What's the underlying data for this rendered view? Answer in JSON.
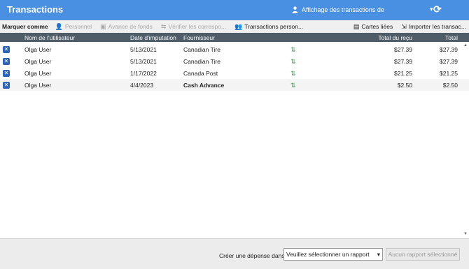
{
  "window": {
    "title": "Transactions"
  },
  "view": {
    "icon": "person-icon",
    "label": "Affichage des transactions de",
    "chevron": "▾",
    "refresh": "⟳"
  },
  "toolbar": {
    "mark_as": "Marquer comme",
    "personal": "Personnel",
    "advance": "Avance de fonds",
    "verify": "Vérifier les correspo...",
    "transactions_person": "Transactions person...",
    "linked_cards": "Cartes liées",
    "import": "Importer les transac..."
  },
  "columns": {
    "user": "Nom de l'utilisateur",
    "date": "Date d'imputation",
    "vendor": "Fournisseur",
    "receipt_total": "Total du reçu",
    "total": "Total"
  },
  "rows": [
    {
      "user": "Olga User",
      "date": "5/13/2021",
      "vendor": "Canadian Tire",
      "receipt_total": "$27.39",
      "total": "$27.39"
    },
    {
      "user": "Olga User",
      "date": "5/13/2021",
      "vendor": "Canadian Tire",
      "receipt_total": "$27.39",
      "total": "$27.39"
    },
    {
      "user": "Olga User",
      "date": "1/17/2022",
      "vendor": "Canada Post",
      "receipt_total": "$21.25",
      "total": "$21.25"
    },
    {
      "user": "Olga User",
      "date": "4/4/2023",
      "vendor": "Cash Advance",
      "receipt_total": "$2.50",
      "total": "$2.50"
    }
  ],
  "footer": {
    "create_label": "Créer une dépense dans :",
    "report_select": "Veuillez sélectionner un rapport",
    "report_button": "Aucun rapport sélectionné"
  }
}
